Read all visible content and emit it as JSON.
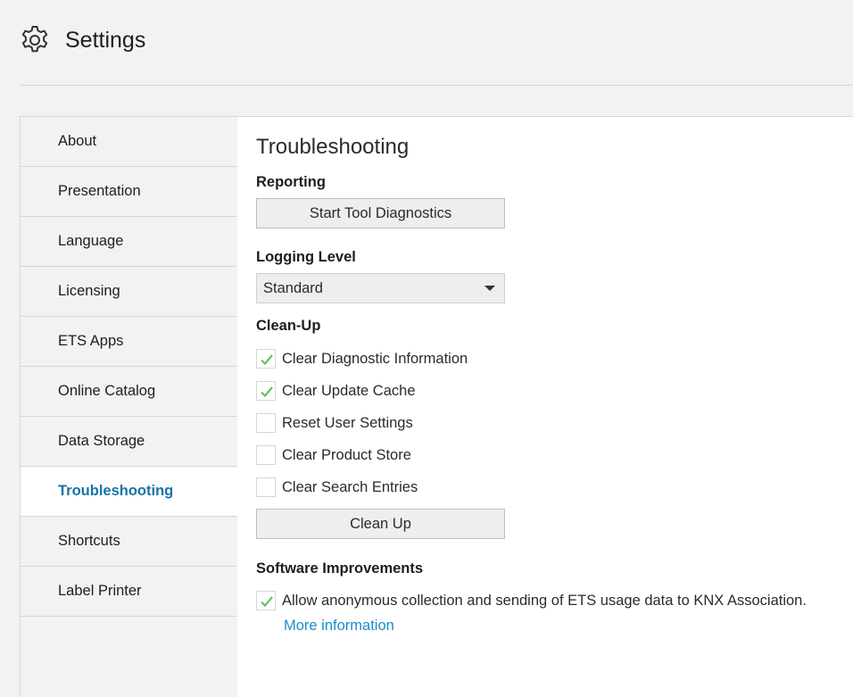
{
  "header": {
    "title": "Settings",
    "icon": "gear-icon"
  },
  "sidebar": {
    "items": [
      {
        "label": "About",
        "active": false
      },
      {
        "label": "Presentation",
        "active": false
      },
      {
        "label": "Language",
        "active": false
      },
      {
        "label": "Licensing",
        "active": false
      },
      {
        "label": "ETS Apps",
        "active": false
      },
      {
        "label": "Online Catalog",
        "active": false
      },
      {
        "label": "Data Storage",
        "active": false
      },
      {
        "label": "Troubleshooting",
        "active": true
      },
      {
        "label": "Shortcuts",
        "active": false
      },
      {
        "label": "Label Printer",
        "active": false
      }
    ]
  },
  "main": {
    "heading": "Troubleshooting",
    "reporting": {
      "label": "Reporting",
      "button_label": "Start Tool Diagnostics"
    },
    "logging": {
      "label": "Logging Level",
      "selected": "Standard"
    },
    "cleanup": {
      "label": "Clean-Up",
      "options": [
        {
          "label": "Clear Diagnostic Information",
          "checked": true
        },
        {
          "label": "Clear Update Cache",
          "checked": true
        },
        {
          "label": "Reset User Settings",
          "checked": false
        },
        {
          "label": "Clear Product Store",
          "checked": false
        },
        {
          "label": "Clear Search Entries",
          "checked": false
        }
      ],
      "button_label": "Clean Up"
    },
    "improvements": {
      "label": "Software Improvements",
      "consent_label": "Allow anonymous collection and sending of ETS usage data to KNX Association.",
      "consent_checked": true,
      "more_info_link": "More information"
    }
  },
  "colors": {
    "accent": "#1a73a8",
    "link": "#1a8ccc",
    "checkmark": "#6abf69"
  }
}
